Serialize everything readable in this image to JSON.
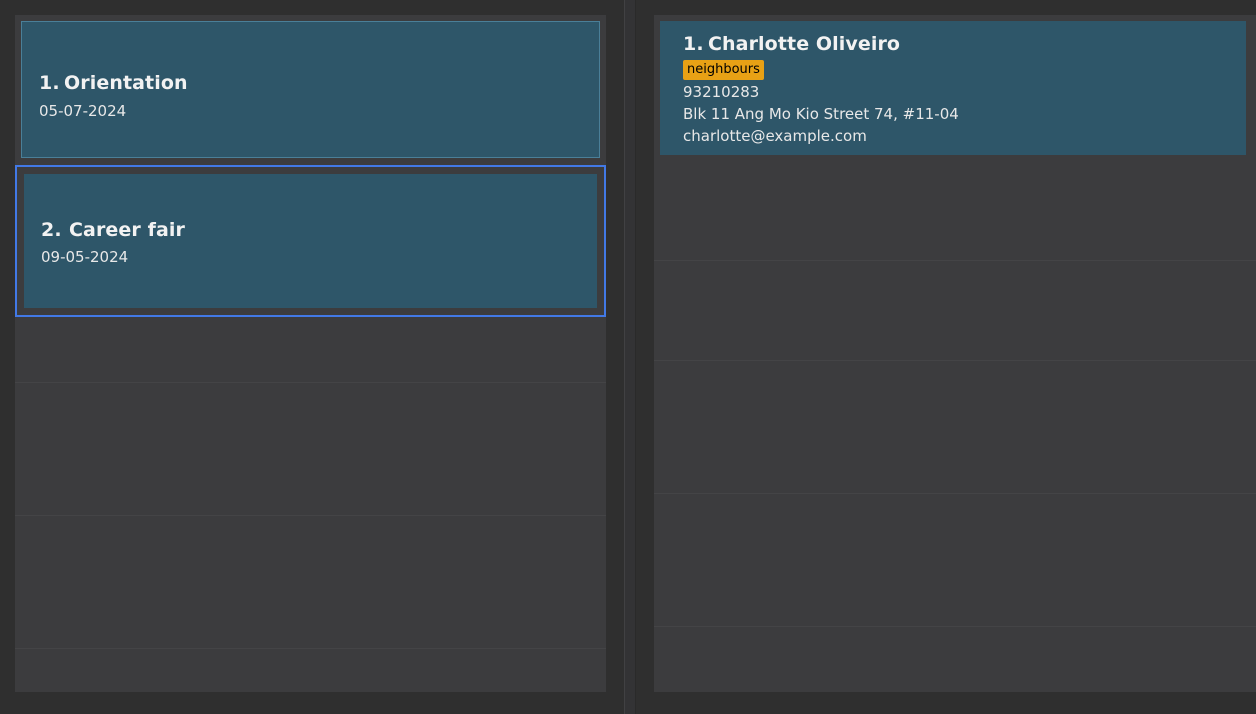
{
  "events": [
    {
      "index": "1.",
      "name": "Orientation",
      "date": "05-07-2024"
    },
    {
      "index": "2.",
      "name": "Career fair",
      "date": "09-05-2024"
    }
  ],
  "persons": [
    {
      "index": "1.",
      "name": "Charlotte Oliveiro",
      "tags": [
        "neighbours"
      ],
      "phone": "93210283",
      "address": "Blk 11 Ang Mo Kio Street 74, #11-04",
      "email": "charlotte@example.com"
    }
  ],
  "colors": {
    "card": "#2e5669",
    "selection": "#4279e6",
    "tag": "#e8a115",
    "background": "#3c3c3e"
  }
}
